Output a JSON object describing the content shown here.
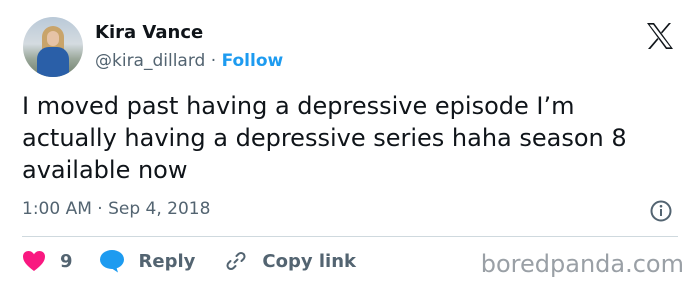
{
  "author": {
    "display_name": "Kira Vance",
    "handle": "@kira_dillard",
    "separator": " · ",
    "follow_label": "Follow"
  },
  "tweet": {
    "text": "I moved past having a depressive episode I’m\nactually having a depressive series haha season 8\navailable now",
    "timestamp": "1:00 AM · Sep 4, 2018"
  },
  "actions": {
    "like_count": "9",
    "reply_label": "Reply",
    "copy_link_label": "Copy link"
  },
  "watermark": "boredpanda.com",
  "icons": {
    "platform": "x-logo-icon",
    "like": "heart-icon",
    "reply": "speech-bubble-icon",
    "copy": "link-icon",
    "info": "info-icon"
  },
  "colors": {
    "accent": "#1d9bf0",
    "like": "#f91880",
    "secondary_text": "#536471",
    "primary_text": "#0f1419"
  }
}
